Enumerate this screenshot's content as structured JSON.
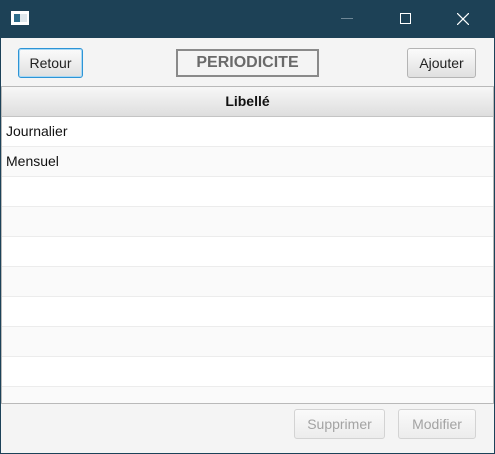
{
  "window": {
    "icon": "app-window-icon",
    "controls": [
      "minimize-icon",
      "maximize-icon",
      "close-icon"
    ]
  },
  "toolbar": {
    "back_label": "Retour",
    "title": "PERIODICITE",
    "add_label": "Ajouter"
  },
  "table": {
    "columns": [
      "Libellé"
    ],
    "rows": [
      "Journalier",
      "Mensuel",
      "",
      "",
      "",
      "",
      "",
      "",
      "",
      ""
    ]
  },
  "footer": {
    "delete_label": "Supprimer",
    "edit_label": "Modifier"
  },
  "colors": {
    "titlebar": "#1d4156",
    "focus_border": "#2d94d6",
    "disabled_text": "#a3a3a3"
  }
}
